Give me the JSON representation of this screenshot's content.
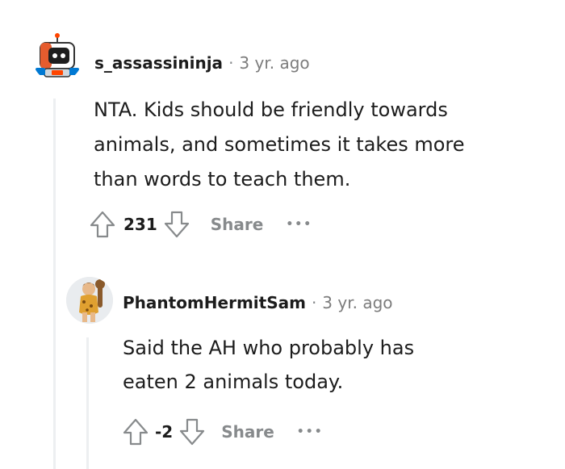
{
  "comments": [
    {
      "author": "s_assassininja",
      "separator": "·",
      "age": "3 yr. ago",
      "body_lines": [
        "NTA. Kids should be friendly towards",
        "animals, and sometimes it takes more",
        "than words to teach them."
      ],
      "score": "231",
      "share_label": "Share",
      "more_label": "•••",
      "avatar_icon": "robot-avatar-icon"
    },
    {
      "author": "PhantomHermitSam",
      "separator": "·",
      "age": "3 yr. ago",
      "body_lines": [
        "Said the AH who probably has",
        "eaten 2 animals today."
      ],
      "score": "-2",
      "share_label": "Share",
      "more_label": "•••",
      "avatar_icon": "caveman-avatar-icon"
    }
  ],
  "colors": {
    "text": "#1c1c1c",
    "meta": "#7c7c7c",
    "muted": "#878a8c",
    "thread_line": "#edeff1"
  }
}
